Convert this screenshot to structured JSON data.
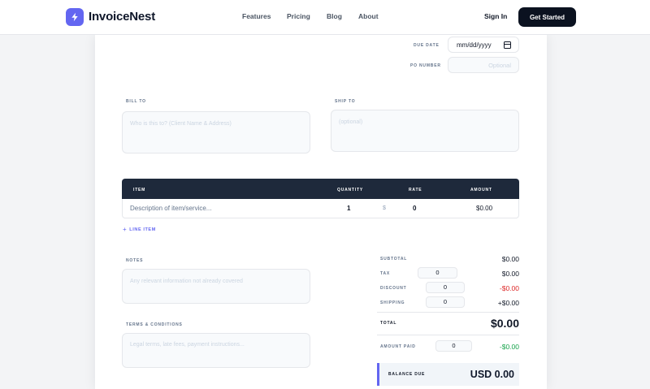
{
  "nav": {
    "brand": "InvoiceNest",
    "links": [
      "Features",
      "Pricing",
      "Blog",
      "About"
    ],
    "signin": "Sign In",
    "cta": "Get Started"
  },
  "meta": {
    "due_date_label": "DUE DATE",
    "due_date_value": "mm/dd/yyyy",
    "po_label": "PO NUMBER",
    "po_placeholder": "Optional"
  },
  "bill_to": {
    "label": "BILL TO",
    "placeholder": "Who is this to? (Client Name & Address)"
  },
  "ship_to": {
    "label": "SHIP TO",
    "placeholder": "(optional)"
  },
  "table": {
    "headers": {
      "item": "ITEM",
      "quantity": "QUANTITY",
      "rate": "RATE",
      "amount": "AMOUNT"
    },
    "row": {
      "description_placeholder": "Description of item/service...",
      "quantity": "1",
      "currency": "$",
      "rate": "0",
      "amount": "$0.00"
    },
    "add_line": "LINE ITEM"
  },
  "notes": {
    "label": "NOTES",
    "placeholder": "Any relevant information not already covered"
  },
  "terms": {
    "label": "TERMS & CONDITIONS",
    "placeholder": "Legal terms, late fees, payment instructions..."
  },
  "totals": {
    "subtotal_label": "SUBTOTAL",
    "subtotal": "$0.00",
    "tax_label": "TAX",
    "tax_input": "0",
    "tax": "$0.00",
    "discount_label": "DISCOUNT",
    "discount_input": "0",
    "discount": "-$0.00",
    "shipping_label": "SHIPPING",
    "shipping_input": "0",
    "shipping": "+$0.00",
    "total_label": "TOTAL",
    "total": "$0.00",
    "amount_paid_label": "AMOUNT PAID",
    "amount_paid_input": "0",
    "amount_paid": "-$0.00",
    "balance_label": "BALANCE DUE",
    "balance": "USD 0.00"
  },
  "colors": {
    "accent": "#6366f1",
    "negative": "#dc2626",
    "positive": "#16a34a",
    "dark": "#1e293b"
  }
}
